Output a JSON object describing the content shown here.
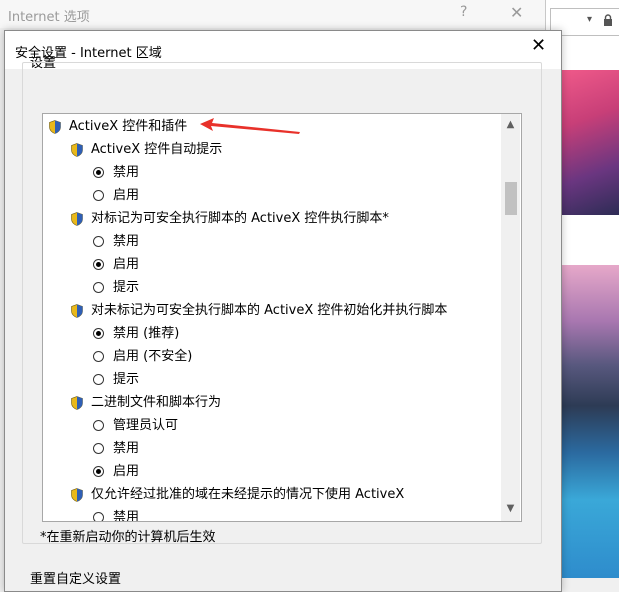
{
  "parent_window": {
    "title": "Internet 选项",
    "help_glyph": "?",
    "close_glyph": "✕"
  },
  "browser": {
    "dropdown_glyph": "▾"
  },
  "dialog": {
    "title": "安全设置 - Internet 区域",
    "close_glyph": "✕",
    "group_label": "设置",
    "footnote": "*在重新启动你的计算机后生效",
    "reset_label": "重置自定义设置"
  },
  "tree": {
    "root": "ActiveX 控件和插件",
    "items": [
      {
        "label": "ActiveX 控件自动提示",
        "options": [
          {
            "label": "禁用",
            "selected": true
          },
          {
            "label": "启用",
            "selected": false
          }
        ]
      },
      {
        "label": "对标记为可安全执行脚本的 ActiveX 控件执行脚本*",
        "options": [
          {
            "label": "禁用",
            "selected": false
          },
          {
            "label": "启用",
            "selected": true
          },
          {
            "label": "提示",
            "selected": false
          }
        ]
      },
      {
        "label": "对未标记为可安全执行脚本的 ActiveX 控件初始化并执行脚本",
        "options": [
          {
            "label": "禁用 (推荐)",
            "selected": true
          },
          {
            "label": "启用 (不安全)",
            "selected": false
          },
          {
            "label": "提示",
            "selected": false
          }
        ]
      },
      {
        "label": "二进制文件和脚本行为",
        "options": [
          {
            "label": "管理员认可",
            "selected": false
          },
          {
            "label": "禁用",
            "selected": false
          },
          {
            "label": "启用",
            "selected": true
          }
        ]
      },
      {
        "label": "仅允许经过批准的域在未经提示的情况下使用 ActiveX",
        "options": [
          {
            "label": "禁用",
            "selected": false
          }
        ]
      }
    ]
  },
  "scrollbar": {
    "up_glyph": "▲",
    "down_glyph": "▼"
  },
  "colors": {
    "annotation_arrow": "#e8312a",
    "icon_shield_blue": "#2f5fb5",
    "icon_shield_yellow": "#e9b81a"
  }
}
